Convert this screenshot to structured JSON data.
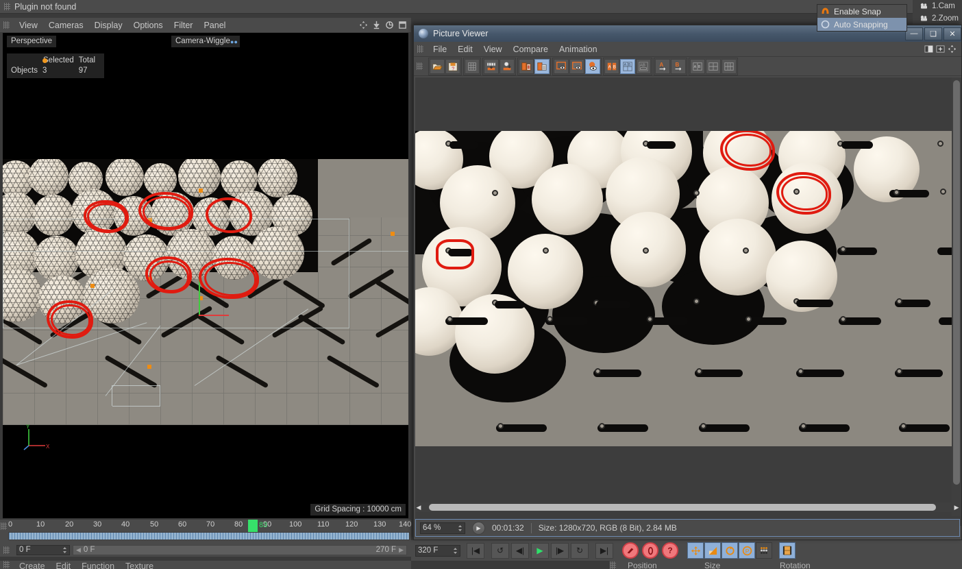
{
  "topbar": {
    "message": "Plugin not found",
    "grip_icon": "drag-grip-icon"
  },
  "viewport_menu": {
    "grip_icon": "drag-grip-icon",
    "items": [
      "View",
      "Cameras",
      "Display",
      "Options",
      "Filter",
      "Panel"
    ],
    "nav_icons": [
      "move-view-icon",
      "zoom-view-icon",
      "rotate-view-icon",
      "maximize-view-icon"
    ]
  },
  "viewport": {
    "projection_label": "Perspective",
    "camera_label": "Camera-Wiggle",
    "grid_spacing": "Grid Spacing : 10000 cm",
    "stats": {
      "col_selected": "Selected",
      "col_total": "Total",
      "row_label": "Objects",
      "selected": "3",
      "total": "97"
    },
    "axis": {
      "y": "Y",
      "x": "X"
    }
  },
  "timeline": {
    "ticks": [
      "0",
      "10",
      "20",
      "30",
      "40",
      "50",
      "60",
      "70",
      "80",
      "90",
      "100",
      "110",
      "120",
      "130",
      "140"
    ],
    "current_frame": "83",
    "playhead_frame": 83
  },
  "frame_row": {
    "current_field": "0 F",
    "range_start": "0 F",
    "range_end": "270 F",
    "prev_arrow_icon": "chevron-left-icon",
    "next_arrow_icon": "chevron-right-icon"
  },
  "bottom_menu": {
    "items": [
      "Create",
      "Edit",
      "Function",
      "Texture"
    ]
  },
  "attribute_row": {
    "labels": [
      "Position",
      "Size",
      "Rotation"
    ]
  },
  "main_toolbar": {
    "end_frame_field": "320 F",
    "transport": [
      {
        "name": "go-to-start-button",
        "glyph": "|◀"
      },
      {
        "name": "previous-key-button",
        "glyph": "↺"
      },
      {
        "name": "step-back-button",
        "glyph": "◀|"
      },
      {
        "name": "play-button",
        "glyph": "▶"
      },
      {
        "name": "step-forward-button",
        "glyph": "|▶"
      },
      {
        "name": "next-key-button",
        "glyph": "↻"
      },
      {
        "name": "go-to-end-button",
        "glyph": "▶|"
      }
    ],
    "record_buttons": [
      {
        "name": "record-active-objects-button",
        "glyph": "⬤"
      },
      {
        "name": "autokeying-button",
        "glyph": "◯"
      },
      {
        "name": "keyframe-selection-button",
        "glyph": "?"
      }
    ],
    "tool_buttons": [
      {
        "name": "move-tool-button",
        "glyph": "✥",
        "selected": true
      },
      {
        "name": "scale-tool-button",
        "glyph": "◸",
        "selected": true
      },
      {
        "name": "rotate-tool-button",
        "glyph": "⟳",
        "selected": true
      },
      {
        "name": "parametric-tool-button",
        "glyph": "P",
        "selected": true
      },
      {
        "name": "point-mode-button",
        "glyph": "⠿",
        "selected": false
      },
      {
        "name": "render-view-button",
        "glyph": "▤",
        "selected": true
      }
    ]
  },
  "snap_menu": {
    "items": [
      {
        "label": "Enable Snap",
        "icon": "snap-magnet-icon",
        "selected": false
      },
      {
        "label": "Auto Snapping",
        "icon": "auto-snap-icon",
        "selected": true
      }
    ]
  },
  "object_manager": {
    "items": [
      {
        "label": "1.Cam",
        "icon": "camera-icon"
      },
      {
        "label": "2.Zoom",
        "icon": "camera-icon"
      }
    ]
  },
  "picture_viewer": {
    "title": "Picture Viewer",
    "logo_icon": "cinema4d-logo-icon",
    "window_buttons": [
      {
        "name": "minimize-button",
        "glyph": "—"
      },
      {
        "name": "maximize-button",
        "glyph": "❑"
      },
      {
        "name": "close-button",
        "glyph": "✕"
      }
    ],
    "menu": {
      "grip_icon": "drag-grip-icon",
      "items": [
        "File",
        "Edit",
        "View",
        "Compare",
        "Animation"
      ],
      "right_icons": [
        "split-layout-icon",
        "add-pane-icon",
        "move-pane-icon"
      ]
    },
    "toolbar": [
      {
        "group": 1,
        "buttons": [
          {
            "name": "open-image-button",
            "icon": "open-folder-icon"
          },
          {
            "name": "save-image-button",
            "icon": "save-disk-icon"
          }
        ]
      },
      {
        "group": 2,
        "buttons": [
          {
            "name": "filter-settings-button",
            "icon": "grid-filter-icon"
          }
        ]
      },
      {
        "group": 3,
        "buttons": [
          {
            "name": "send-to-a-button",
            "icon": "load-to-a-icon"
          },
          {
            "name": "send-to-b-button",
            "icon": "load-to-b-icon"
          }
        ]
      },
      {
        "group": 4,
        "buttons": [
          {
            "name": "delete-image-button",
            "icon": "trash-icon"
          },
          {
            "name": "clear-history-button",
            "icon": "clear-list-icon",
            "selected": true
          }
        ]
      },
      {
        "group": 5,
        "buttons": [
          {
            "name": "show-single-view-button",
            "icon": "single-view-icon"
          },
          {
            "name": "show-compare-view-button",
            "icon": "compare-view-icon"
          },
          {
            "name": "show-difference-button",
            "icon": "difference-view-icon",
            "selected": true
          }
        ]
      },
      {
        "group": 6,
        "buttons": [
          {
            "name": "ab-compare-button",
            "icon": "ab-compare-icon"
          },
          {
            "name": "ab-grid-button",
            "icon": "ab-grid-icon",
            "selected": true
          },
          {
            "name": "ab-blend-button",
            "icon": "ab-blend-icon"
          }
        ]
      },
      {
        "group": 7,
        "buttons": [
          {
            "name": "set-a-button",
            "icon": "a-arrow-icon"
          },
          {
            "name": "set-b-button",
            "icon": "b-arrow-icon"
          }
        ]
      },
      {
        "group": 8,
        "buttons": [
          {
            "name": "layout-single-button",
            "icon": "layout-single-icon"
          },
          {
            "name": "layout-quad-button",
            "icon": "layout-quad-icon"
          },
          {
            "name": "layout-list-button",
            "icon": "layout-list-icon"
          }
        ]
      }
    ],
    "status": {
      "zoom": "64 %",
      "play_icon": "play-icon",
      "time": "00:01:32",
      "info": "Size: 1280x720, RGB (8 Bit), 2.84 MB"
    }
  },
  "colors": {
    "window_bg": "#4a4a4a",
    "viewport_bg": "#000000",
    "render_ground": "#8c8880",
    "accent_orange": "#ef8c12",
    "annotation_red": "#e01b10",
    "playhead_green": "#36e06a",
    "selected_blue": "#9bb8dd"
  }
}
